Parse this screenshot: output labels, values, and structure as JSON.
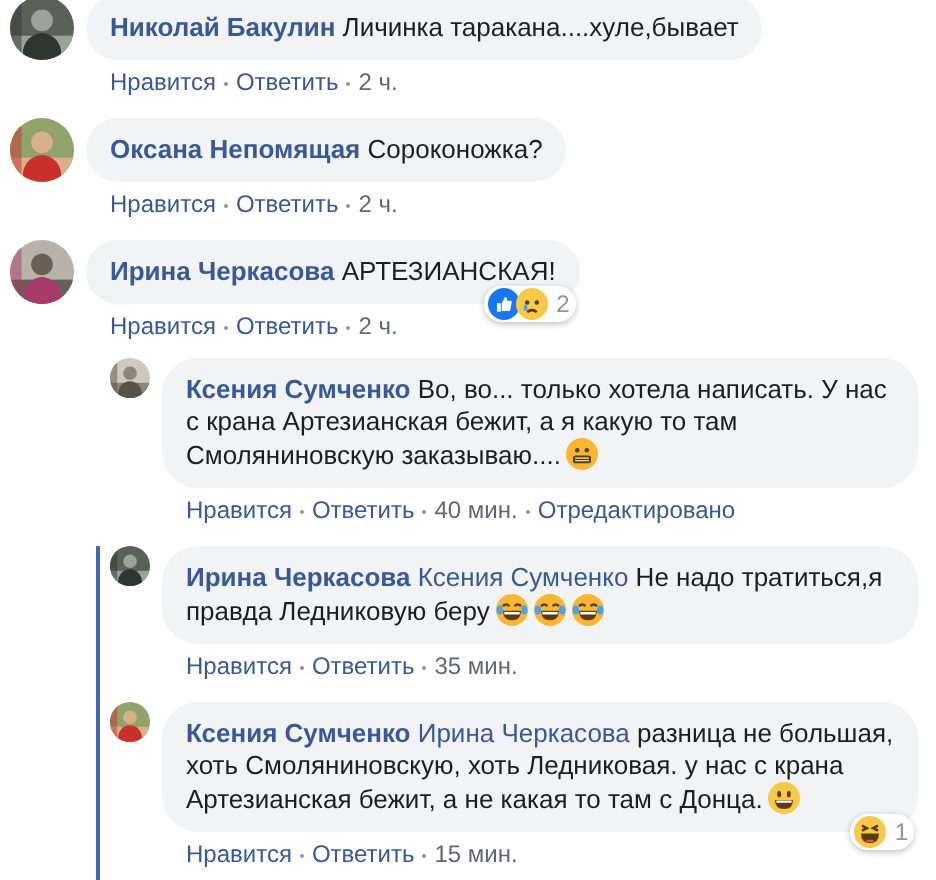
{
  "comments": [
    {
      "author": "Николай Бакулин",
      "avatar": {
        "kind": "picture"
      },
      "parts": [
        {
          "kind": "text",
          "text": "Личинка таракана....хуле,бывает"
        }
      ],
      "actions": {
        "like": "Нравится",
        "reply": "Ответить",
        "time": "2 ч."
      }
    },
    {
      "author": "Оксана Непомящая",
      "avatar": {
        "kind": "picture"
      },
      "parts": [
        {
          "kind": "text",
          "text": "Сороконожка?"
        }
      ],
      "actions": {
        "like": "Нравится",
        "reply": "Ответить",
        "time": "2 ч."
      }
    },
    {
      "author": "Ирина Черкасова",
      "avatar": {
        "kind": "picture"
      },
      "parts": [
        {
          "kind": "text",
          "text": "АРТЕЗИАНСКАЯ!"
        }
      ],
      "reactions": {
        "icons": [
          {
            "kind": "like"
          },
          {
            "kind": "sad"
          }
        ],
        "count": "2"
      },
      "actions": {
        "like": "Нравится",
        "reply": "Ответить",
        "time": "2 ч."
      },
      "replies": [
        {
          "author": "Ксения Сумченко",
          "highlighted": false,
          "avatar": {
            "kind": "picture"
          },
          "parts": [
            {
              "kind": "text",
              "text": "Во, во... только хотела написать. У нас с крана Артезианская бежит, а я какую то там Смоляниновскую заказываю...."
            },
            {
              "kind": "grimace"
            }
          ],
          "actions": {
            "like": "Нравится",
            "reply": "Ответить",
            "time": "40 мин.",
            "edited": "Отредактировано"
          }
        },
        {
          "author": "Ирина Черкасова",
          "highlighted": true,
          "avatar": {
            "kind": "picture"
          },
          "parts": [
            {
              "kind": "mention",
              "text": "Ксения Сумченко"
            },
            {
              "kind": "text",
              "text": "Не надо тратиться,я правда Ледниковую беру"
            },
            {
              "kind": "tears-of-joy"
            },
            {
              "kind": "tears-of-joy"
            },
            {
              "kind": "tears-of-joy"
            }
          ],
          "actions": {
            "like": "Нравится",
            "reply": "Ответить",
            "time": "35 мин."
          }
        },
        {
          "author": "Ксения Сумченко",
          "highlighted": true,
          "avatar": {
            "kind": "picture"
          },
          "parts": [
            {
              "kind": "mention",
              "text": "Ирина Черкасова"
            },
            {
              "kind": "text",
              "text": "разница не большая, хоть Смоляниновскую, хоть Ледниковая. у нас с крана Артезианская бежит, а не какая то там с Донца."
            },
            {
              "kind": "smile"
            }
          ],
          "reactions": {
            "icons": [
              {
                "kind": "haha"
              }
            ],
            "count": "1"
          },
          "actions": {
            "like": "Нравится",
            "reply": "Ответить",
            "time": "15 мин."
          }
        }
      ]
    }
  ]
}
